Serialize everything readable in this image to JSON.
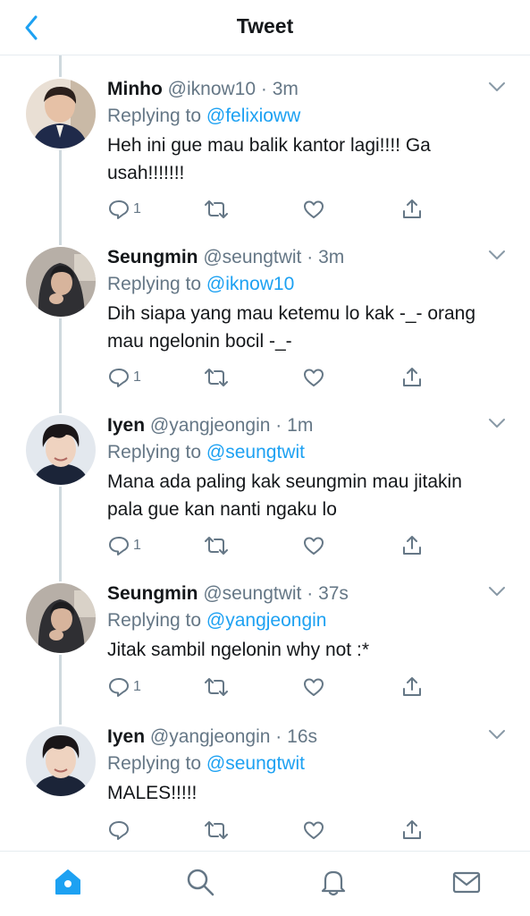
{
  "header": {
    "title": "Tweet"
  },
  "colors": {
    "accent": "#1da1f2",
    "secondary": "#657786",
    "text": "#14171a",
    "divider": "#e6ecf0"
  },
  "tweets": [
    {
      "name": "Minho",
      "handle": "@iknow10",
      "time": "3m",
      "replying_prefix": "Replying to",
      "replying_to": "@felixioww",
      "text": "Heh ini gue mau balik kantor lagi!!!! Ga usah!!!!!!!",
      "reply_count": "1"
    },
    {
      "name": "Seungmin",
      "handle": "@seungtwit",
      "time": "3m",
      "replying_prefix": "Replying to",
      "replying_to": "@iknow10",
      "text": "Dih siapa yang mau ketemu lo kak -_- orang mau ngelonin bocil -_-",
      "reply_count": "1"
    },
    {
      "name": "Iyen",
      "handle": "@yangjeongin",
      "time": "1m",
      "replying_prefix": "Replying to",
      "replying_to": "@seungtwit",
      "text": "Mana ada paling kak seungmin mau jitakin pala gue kan nanti ngaku lo",
      "reply_count": "1"
    },
    {
      "name": "Seungmin",
      "handle": "@seungtwit",
      "time": "37s",
      "replying_prefix": "Replying to",
      "replying_to": "@yangjeongin",
      "text": "Jitak sambil ngelonin why not :*",
      "reply_count": "1"
    },
    {
      "name": "Iyen",
      "handle": "@yangjeongin",
      "time": "16s",
      "replying_prefix": "Replying to",
      "replying_to": "@seungtwit",
      "text": "MALES!!!!!",
      "reply_count": ""
    }
  ],
  "tabbar": {
    "items": [
      "home-icon",
      "search-icon",
      "notifications-icon",
      "messages-icon"
    ]
  }
}
